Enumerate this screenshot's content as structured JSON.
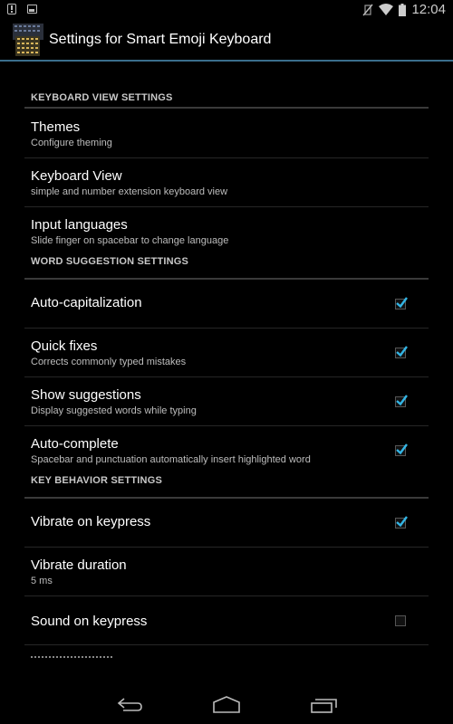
{
  "status_bar": {
    "left_icons": [
      "alert-notification-icon",
      "image-notification-icon"
    ],
    "right_icons": [
      "vibrate-off-icon",
      "wifi-icon",
      "battery-icon"
    ],
    "time": "12:04"
  },
  "action_bar": {
    "app_icon": "emoji-keyboard-app-icon",
    "title": "Settings for Smart Emoji Keyboard"
  },
  "colors": {
    "accent": "#33b5e5",
    "divider_accent": "#3a6e8c",
    "background": "#000000"
  },
  "sections": [
    {
      "header": "KEYBOARD VIEW SETTINGS",
      "items": [
        {
          "title": "Themes",
          "summary": "Configure theming"
        },
        {
          "title": "Keyboard View",
          "summary": "simple and number extension keyboard view"
        },
        {
          "title": "Input languages",
          "summary": "Slide finger on spacebar to change language"
        }
      ]
    },
    {
      "header": "WORD SUGGESTION SETTINGS",
      "items": [
        {
          "title": "Auto-capitalization",
          "summary": "",
          "checked": true
        },
        {
          "title": "Quick fixes",
          "summary": "Corrects commonly typed mistakes",
          "checked": true
        },
        {
          "title": "Show suggestions",
          "summary": "Display suggested words while typing",
          "checked": true
        },
        {
          "title": "Auto-complete",
          "summary": "Spacebar and punctuation automatically insert highlighted word",
          "checked": true
        }
      ]
    },
    {
      "header": "KEY BEHAVIOR SETTINGS",
      "items": [
        {
          "title": "Vibrate on keypress",
          "summary": "",
          "checked": true
        },
        {
          "title": "Vibrate duration",
          "summary": "5 ms"
        },
        {
          "title": "Sound on keypress",
          "summary": "",
          "checked": false
        }
      ]
    }
  ],
  "nav_bar": {
    "buttons": [
      "back-icon",
      "home-icon",
      "recent-apps-icon"
    ]
  }
}
